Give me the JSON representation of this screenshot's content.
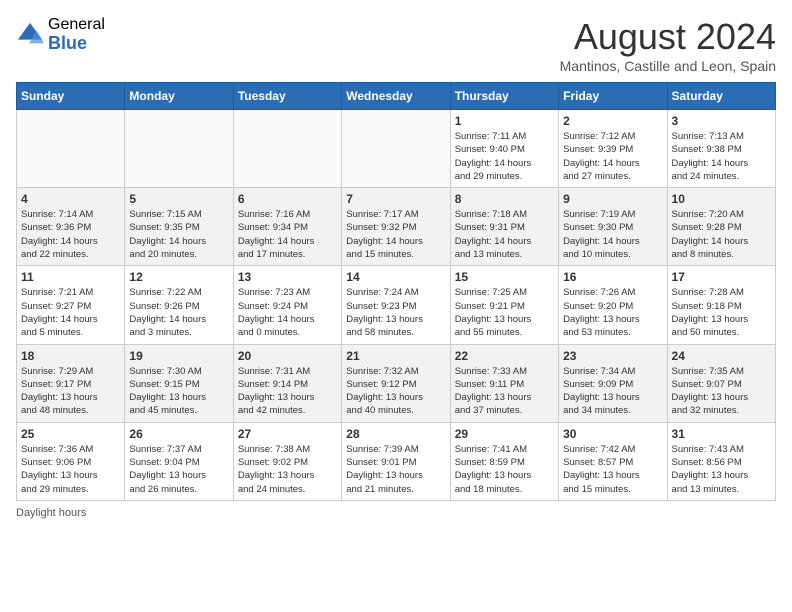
{
  "header": {
    "logo_general": "General",
    "logo_blue": "Blue",
    "month_year": "August 2024",
    "location": "Mantinos, Castille and Leon, Spain"
  },
  "days_of_week": [
    "Sunday",
    "Monday",
    "Tuesday",
    "Wednesday",
    "Thursday",
    "Friday",
    "Saturday"
  ],
  "weeks": [
    [
      {
        "day": "",
        "info": ""
      },
      {
        "day": "",
        "info": ""
      },
      {
        "day": "",
        "info": ""
      },
      {
        "day": "",
        "info": ""
      },
      {
        "day": "1",
        "info": "Sunrise: 7:11 AM\nSunset: 9:40 PM\nDaylight: 14 hours\nand 29 minutes."
      },
      {
        "day": "2",
        "info": "Sunrise: 7:12 AM\nSunset: 9:39 PM\nDaylight: 14 hours\nand 27 minutes."
      },
      {
        "day": "3",
        "info": "Sunrise: 7:13 AM\nSunset: 9:38 PM\nDaylight: 14 hours\nand 24 minutes."
      }
    ],
    [
      {
        "day": "4",
        "info": "Sunrise: 7:14 AM\nSunset: 9:36 PM\nDaylight: 14 hours\nand 22 minutes."
      },
      {
        "day": "5",
        "info": "Sunrise: 7:15 AM\nSunset: 9:35 PM\nDaylight: 14 hours\nand 20 minutes."
      },
      {
        "day": "6",
        "info": "Sunrise: 7:16 AM\nSunset: 9:34 PM\nDaylight: 14 hours\nand 17 minutes."
      },
      {
        "day": "7",
        "info": "Sunrise: 7:17 AM\nSunset: 9:32 PM\nDaylight: 14 hours\nand 15 minutes."
      },
      {
        "day": "8",
        "info": "Sunrise: 7:18 AM\nSunset: 9:31 PM\nDaylight: 14 hours\nand 13 minutes."
      },
      {
        "day": "9",
        "info": "Sunrise: 7:19 AM\nSunset: 9:30 PM\nDaylight: 14 hours\nand 10 minutes."
      },
      {
        "day": "10",
        "info": "Sunrise: 7:20 AM\nSunset: 9:28 PM\nDaylight: 14 hours\nand 8 minutes."
      }
    ],
    [
      {
        "day": "11",
        "info": "Sunrise: 7:21 AM\nSunset: 9:27 PM\nDaylight: 14 hours\nand 5 minutes."
      },
      {
        "day": "12",
        "info": "Sunrise: 7:22 AM\nSunset: 9:26 PM\nDaylight: 14 hours\nand 3 minutes."
      },
      {
        "day": "13",
        "info": "Sunrise: 7:23 AM\nSunset: 9:24 PM\nDaylight: 14 hours\nand 0 minutes."
      },
      {
        "day": "14",
        "info": "Sunrise: 7:24 AM\nSunset: 9:23 PM\nDaylight: 13 hours\nand 58 minutes."
      },
      {
        "day": "15",
        "info": "Sunrise: 7:25 AM\nSunset: 9:21 PM\nDaylight: 13 hours\nand 55 minutes."
      },
      {
        "day": "16",
        "info": "Sunrise: 7:26 AM\nSunset: 9:20 PM\nDaylight: 13 hours\nand 53 minutes."
      },
      {
        "day": "17",
        "info": "Sunrise: 7:28 AM\nSunset: 9:18 PM\nDaylight: 13 hours\nand 50 minutes."
      }
    ],
    [
      {
        "day": "18",
        "info": "Sunrise: 7:29 AM\nSunset: 9:17 PM\nDaylight: 13 hours\nand 48 minutes."
      },
      {
        "day": "19",
        "info": "Sunrise: 7:30 AM\nSunset: 9:15 PM\nDaylight: 13 hours\nand 45 minutes."
      },
      {
        "day": "20",
        "info": "Sunrise: 7:31 AM\nSunset: 9:14 PM\nDaylight: 13 hours\nand 42 minutes."
      },
      {
        "day": "21",
        "info": "Sunrise: 7:32 AM\nSunset: 9:12 PM\nDaylight: 13 hours\nand 40 minutes."
      },
      {
        "day": "22",
        "info": "Sunrise: 7:33 AM\nSunset: 9:11 PM\nDaylight: 13 hours\nand 37 minutes."
      },
      {
        "day": "23",
        "info": "Sunrise: 7:34 AM\nSunset: 9:09 PM\nDaylight: 13 hours\nand 34 minutes."
      },
      {
        "day": "24",
        "info": "Sunrise: 7:35 AM\nSunset: 9:07 PM\nDaylight: 13 hours\nand 32 minutes."
      }
    ],
    [
      {
        "day": "25",
        "info": "Sunrise: 7:36 AM\nSunset: 9:06 PM\nDaylight: 13 hours\nand 29 minutes."
      },
      {
        "day": "26",
        "info": "Sunrise: 7:37 AM\nSunset: 9:04 PM\nDaylight: 13 hours\nand 26 minutes."
      },
      {
        "day": "27",
        "info": "Sunrise: 7:38 AM\nSunset: 9:02 PM\nDaylight: 13 hours\nand 24 minutes."
      },
      {
        "day": "28",
        "info": "Sunrise: 7:39 AM\nSunset: 9:01 PM\nDaylight: 13 hours\nand 21 minutes."
      },
      {
        "day": "29",
        "info": "Sunrise: 7:41 AM\nSunset: 8:59 PM\nDaylight: 13 hours\nand 18 minutes."
      },
      {
        "day": "30",
        "info": "Sunrise: 7:42 AM\nSunset: 8:57 PM\nDaylight: 13 hours\nand 15 minutes."
      },
      {
        "day": "31",
        "info": "Sunrise: 7:43 AM\nSunset: 8:56 PM\nDaylight: 13 hours\nand 13 minutes."
      }
    ]
  ],
  "footer": {
    "daylight_label": "Daylight hours"
  }
}
